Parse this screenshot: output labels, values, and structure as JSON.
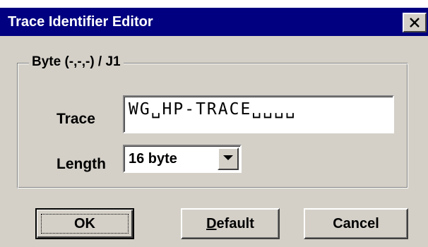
{
  "window": {
    "title": "Trace Identifier Editor",
    "close_glyph": "✕"
  },
  "group": {
    "legend": "Byte (-,-,-) / J1"
  },
  "trace": {
    "label": "Trace",
    "value": "WG␣HP-TRACE␣␣␣␣"
  },
  "length": {
    "label": "Length",
    "selected": "16 byte"
  },
  "buttons": {
    "ok_label": "OK",
    "default_mnemonic": "D",
    "default_rest": "efault",
    "cancel_label": "Cancel"
  },
  "colors": {
    "titlebar": "#000080",
    "face": "#d4d0c8",
    "field": "#ffffff"
  }
}
